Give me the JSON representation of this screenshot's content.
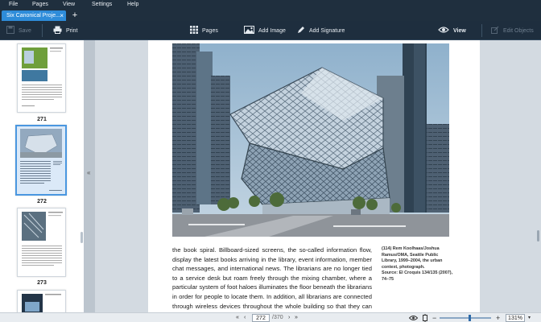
{
  "menu": [
    "File",
    "Pages",
    "View",
    "Settings",
    "Help"
  ],
  "tab": {
    "title": "Six Canonical Proje...",
    "close": "×",
    "add": "+"
  },
  "toolbar": {
    "save": "Save",
    "print": "Print",
    "pages": "Pages",
    "add_image": "Add Image",
    "add_signature": "Add Signature",
    "view": "View",
    "edit_objects": "Edit Objects"
  },
  "thumbnails": [
    {
      "num": "271",
      "selected": false
    },
    {
      "num": "272",
      "selected": true
    },
    {
      "num": "273",
      "selected": false
    }
  ],
  "document": {
    "body_text": "the book spiral. Billboard-sized screens, the so-called information flow, display the latest books arriving in the library, event information, member chat messages, and international news. The librarians are no longer tied to a service desk but roam freely through the mixing chamber, where a particular system of foot haloes illuminates the floor beneath the librarians in order for people to locate them. In addition, all librarians are connected through wireless devices throughout the whole building so that they can immediately consult with colleagues",
    "caption_lines": [
      "(114) Rem Koolhaas/Joshua",
      "Ramus/OMA, Seattle Public",
      "Library, 1999–2004, the urban",
      "context, photograph.",
      "Source: El Croquis 134/135 (2007),",
      "74–75"
    ]
  },
  "status": {
    "current_page": "272",
    "total_pages": "/370",
    "zoom": "131%",
    "zoom_minus": "−",
    "zoom_plus": "+"
  },
  "colors": {
    "accent": "#2e8cd9",
    "toolbar_bg": "#1e2e3e",
    "selection": "#4a97e0"
  }
}
